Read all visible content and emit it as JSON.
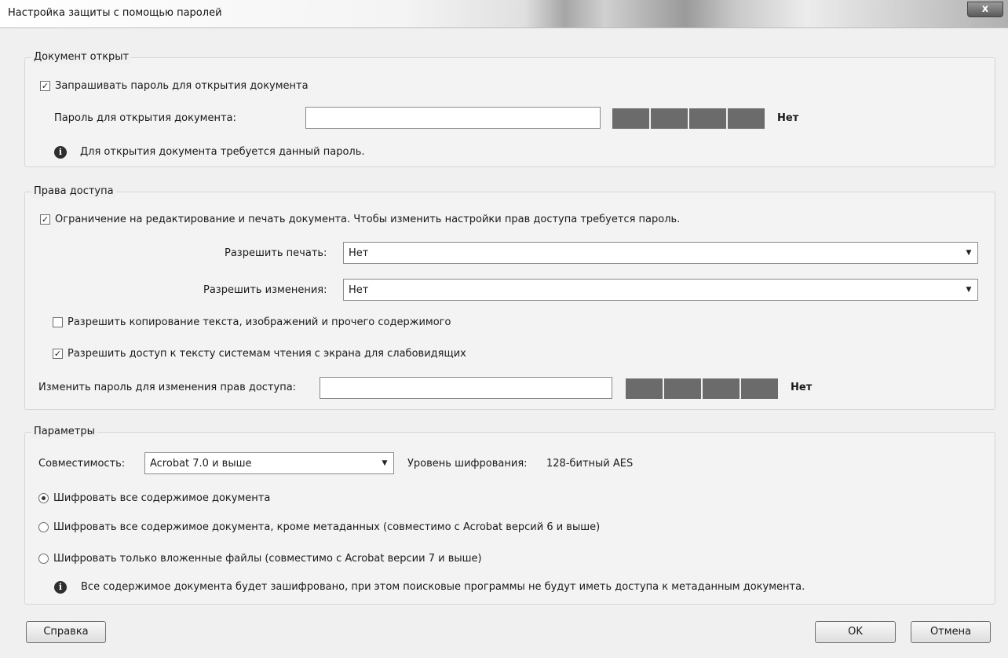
{
  "window": {
    "title": "Настройка защиты с помощью паролей",
    "close_label": "x"
  },
  "doc_open": {
    "group_title": "Документ открыт",
    "require_password_label": "Запрашивать пароль для открытия документа",
    "require_password_checked": true,
    "password_label": "Пароль для открытия документа:",
    "password_value": "",
    "strength_label": "Нет",
    "info_text": "Для открытия документа требуется данный пароль."
  },
  "permissions": {
    "group_title": "Права доступа",
    "restrict_label": "Ограничение на редактирование и печать документа. Чтобы изменить настройки прав доступа требуется пароль.",
    "restrict_checked": true,
    "print_label": "Разрешить печать:",
    "print_value": "Нет",
    "changes_label": "Разрешить изменения:",
    "changes_value": "Нет",
    "copy_label": "Разрешить копирование текста, изображений и прочего содержимого",
    "copy_checked": false,
    "screenreader_label": "Разрешить доступ к тексту системам чтения с экрана для слабовидящих",
    "screenreader_checked": true,
    "perm_password_label": "Изменить пароль для изменения прав доступа:",
    "perm_password_value": "",
    "strength_label": "Нет"
  },
  "options": {
    "group_title": "Параметры",
    "compat_label": "Совместимость:",
    "compat_value": "Acrobat 7.0 и выше",
    "encryption_level_label": "Уровень шифрования:",
    "encryption_level_value": "128-битный AES",
    "radio_all": "Шифровать все содержимое документа",
    "radio_except_meta": "Шифровать все содержимое документа, кроме метаданных (совместимо с Acrobat версий 6 и выше)",
    "radio_attachments": "Шифровать только вложенные файлы (совместимо с Acrobat версии 7 и выше)",
    "selected_radio": "all",
    "info_text": "Все содержимое документа будет зашифровано, при этом поисковые программы не будут иметь доступа к метаданным документа."
  },
  "buttons": {
    "help": "Справка",
    "ok": "OK",
    "cancel": "Отмена"
  },
  "icons": {
    "checkmark": "✓",
    "info": "i",
    "dropdown": "▼"
  }
}
